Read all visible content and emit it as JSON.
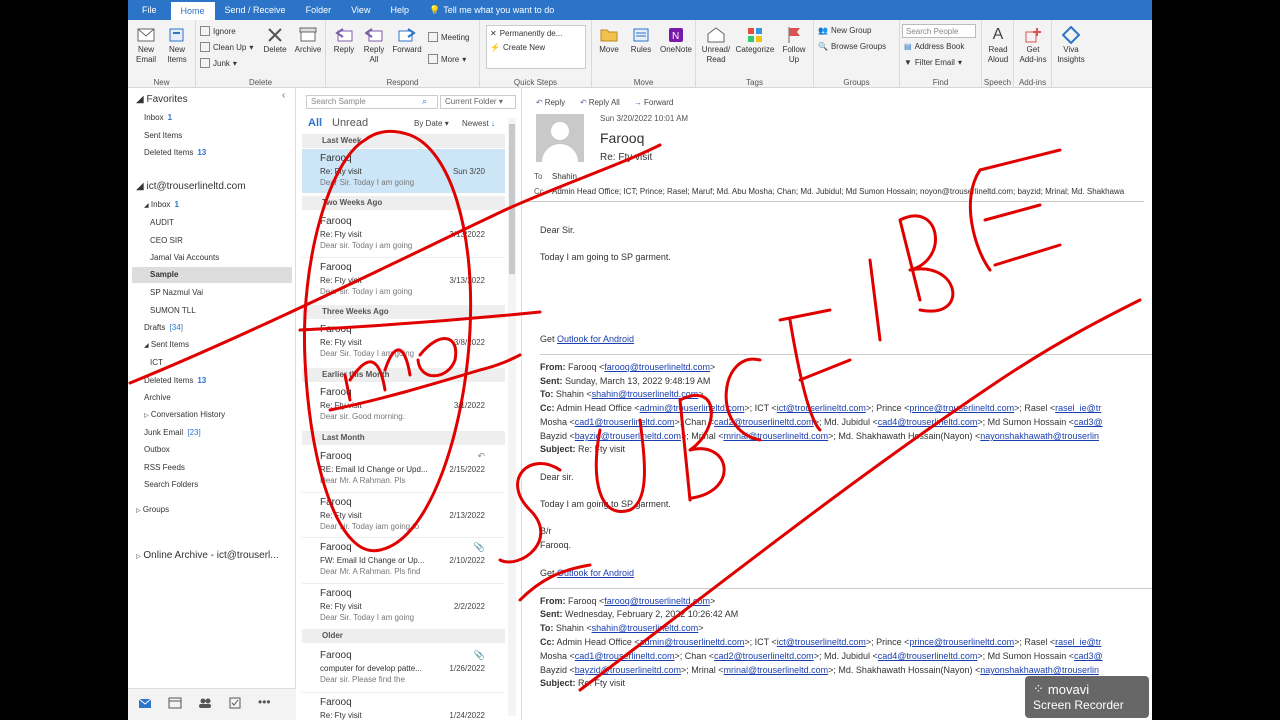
{
  "ribbon_tabs": [
    "File",
    "Home",
    "Send / Receive",
    "Folder",
    "View",
    "Help",
    "Tell me what you want to do"
  ],
  "ribbon": {
    "new_email": "New\nEmail",
    "new_items": "New\nItems",
    "ignore": "Ignore",
    "clean_up": "Clean Up",
    "junk": "Junk",
    "delete": "Delete",
    "archive": "Archive",
    "reply": "Reply",
    "reply_all": "Reply\nAll",
    "forward": "Forward",
    "meeting": "Meeting",
    "more": "More",
    "qs_permanently": "Permanently de...",
    "qs_create_new": "Create New",
    "move": "Move",
    "rules": "Rules",
    "onenote": "OneNote",
    "unread_read": "Unread/\nRead",
    "categorize": "Categorize",
    "follow_up": "Follow\nUp",
    "new_group": "New Group",
    "browse_groups": "Browse Groups",
    "search_people": "Search People",
    "address_book": "Address Book",
    "filter_email": "Filter Email",
    "read_aloud": "Read\nAloud",
    "get_addins": "Get\nAdd-ins",
    "viva_insights": "Viva\nInsights",
    "groups": {
      "new": "New",
      "delete": "Delete",
      "respond": "Respond",
      "quick_steps": "Quick Steps",
      "move": "Move",
      "tags": "Tags",
      "groups": "Groups",
      "find": "Find",
      "speech": "Speech",
      "addins": "Add-ins"
    }
  },
  "folders": {
    "favorites": "Favorites",
    "fav_inbox": "Inbox",
    "fav_inbox_count": "1",
    "fav_sent": "Sent Items",
    "fav_deleted": "Deleted Items",
    "fav_deleted_count": "13",
    "account": "ict@trouserlineltd.com",
    "inbox": "Inbox",
    "inbox_count": "1",
    "audit": "AUDIT",
    "ceo": "CEO SIR",
    "jamal": "Jamal  Vai Accounts",
    "sample": "Sample",
    "sp_nazmul": "SP Nazmul Vai",
    "sumon": "SUMON TLL",
    "drafts": "Drafts",
    "drafts_count": "[34]",
    "sent": "Sent Items",
    "ict": "ICT",
    "deleted": "Deleted Items",
    "deleted_count": "13",
    "archive": "Archive",
    "conversation": "Conversation History",
    "junk": "Junk Email",
    "junk_count": "[23]",
    "outbox": "Outbox",
    "rss": "RSS Feeds",
    "search_folders": "Search Folders",
    "groups": "Groups",
    "online_archive": "Online Archive - ict@trouserl..."
  },
  "list": {
    "search_placeholder": "Search Sample",
    "current_folder": "Current Folder",
    "all": "All",
    "unread": "Unread",
    "by_date": "By Date",
    "newest": "Newest",
    "groups": [
      "Last Week",
      "Two Weeks Ago",
      "Three Weeks Ago",
      "Earlier this Month",
      "Last Month",
      "Older"
    ],
    "messages": [
      {
        "sender": "Farooq",
        "subject": "Re: Fty visit",
        "preview": "Dear Sir.  Today I am going",
        "date": "Sun 3/20"
      },
      {
        "sender": "Farooq",
        "subject": "Re: Fty visit",
        "preview": "Dear sir.  Today i am going",
        "date": "3/13/2022"
      },
      {
        "sender": "Farooq",
        "subject": "Re: Fty visit",
        "preview": "Dear sir.  Today  i am going",
        "date": "3/13/2022"
      },
      {
        "sender": "Farooq",
        "subject": "Re: Fty visit",
        "preview": "Dear Sir.  Today I am going",
        "date": "3/8/2022"
      },
      {
        "sender": "Farooq",
        "subject": "Re: Fty visit",
        "preview": "Dear sir.  Good morning.",
        "date": "3/1/2022"
      },
      {
        "sender": "Farooq",
        "subject": "RE: Email Id Change or Upd...",
        "preview": "Dear Mr. A Rahman.   Pls",
        "date": "2/15/2022"
      },
      {
        "sender": "Farooq",
        "subject": "Re: Fty visit",
        "preview": "Dear sir.  Today iam going to",
        "date": "2/13/2022"
      },
      {
        "sender": "Farooq",
        "subject": "FW: Email Id Change or Up...",
        "preview": "Dear Mr. A Rahman.   Pls find",
        "date": "2/10/2022"
      },
      {
        "sender": "Farooq",
        "subject": "Re: Fty visit",
        "preview": "Dear Sir.  Today I am going",
        "date": "2/2/2022"
      },
      {
        "sender": "Farooq",
        "subject": "computer for develop patte...",
        "preview": "Dear sir.  Please find the",
        "date": "1/26/2022"
      },
      {
        "sender": "Farooq",
        "subject": "Re: Fty visit",
        "preview": "",
        "date": "1/24/2022"
      }
    ]
  },
  "reader": {
    "reply": "Reply",
    "reply_all": "Reply All",
    "forward": "Forward",
    "date": "Sun 3/20/2022 10:01 AM",
    "sender": "Farooq",
    "subject": "Re: Fty visit",
    "to_label": "To",
    "to": "Shahin",
    "cc_label": "Cc",
    "cc": "Admin Head Office; ICT; Prince; Rasel; Maruf; Md. Abu Mosha; Chan; Md. Jubidul; Md Sumon Hossain; noyon@trouserlineltd.com; bayzid; Mrinal; Md. Shakhawa",
    "greeting": "Dear Sir.",
    "line1": "Today I am going to SP garment.",
    "get_outlook": "Get ",
    "outlook_android": "Outlook for Android",
    "q1": {
      "from_label": "From:",
      "from": " Farooq <",
      "from_email": "farooq@trouserlineltd.com",
      "from_end": ">",
      "sent_label": "Sent:",
      "sent": " Sunday, March 13, 2022 9:48:19 AM",
      "to_label": "To:",
      "to": " Shahin <",
      "to_email": "shahin@trouserlineltd.com",
      "to_end": ">",
      "cc_label": "Cc:",
      "cc1": " Admin Head Office <",
      "cc1_email": "admin@trouserlineltd.com",
      "cc1_rest": ">; ICT <",
      "cc2_email": "ict@trouserlineltd.com",
      "cc2_rest": ">; Prince <",
      "cc3_email": "prince@trouserlineltd.com",
      "cc3_rest": ">; Rasel <",
      "cc4_email": "rasel_ie@tr",
      "line2a": "Mosha <",
      "line2_e1": "cad1@trouserlineltd.com",
      "line2b": ">; Chan <",
      "line2_e2": "cad2@trouserlineltd.com",
      "line2c": ">; Md. Jubidul <",
      "line2_e3": "cad4@trouserlineltd.com",
      "line2d": ">; Md Sumon Hossain <",
      "line2_e4": "cad3@",
      "line3a": "Bayzid <",
      "line3_e1": "bayzid@trouserlineltd.com",
      "line3b": ">; Mrinal <",
      "line3_e2": "mrinal@trouserlineltd.com",
      "line3c": ">; Md. Shakhawath Hossain(Nayon) <",
      "line3_e3": "nayonshakhawath@trouserlin",
      "subject_label": "Subject:",
      "subject": " Re: Fty visit",
      "greeting": "Dear sir.",
      "line1": "Today I am going to SP garment.",
      "br": "B/r",
      "name": "Farooq."
    },
    "q2": {
      "from_label": "From:",
      "from": " Farooq <",
      "from_email": "farooq@trouserlineltd.com",
      "from_end": ">",
      "sent_label": "Sent:",
      "sent": " Wednesday, February 2, 2022 10:26:42 AM",
      "to_label": "To:",
      "to": " Shahin <",
      "to_email": "shahin@trouserlineltd.com",
      "to_end": ">",
      "cc_label": "Cc:",
      "cc1": " Admin Head Office <",
      "cc1_email": "admin@trouserlineltd.com",
      "cc1_rest": ">; ICT <",
      "cc2_email": "ict@trouserlineltd.com",
      "cc2_rest": ">; Prince <",
      "cc3_email": "prince@trouserlineltd.com",
      "cc3_rest": ">; Rasel <",
      "cc4_email": "rasel_ie@tr",
      "line2a": "Mosha <",
      "line2_e1": "cad1@trouserlineltd.com",
      "line2b": ">; Chan <",
      "line2_e2": "cad2@trouserlineltd.com",
      "line2c": ">; Md. Jubidul <",
      "line2_e3": "cad4@trouserlineltd.com",
      "line2d": ">; Md Sumon Hossain <",
      "line2_e4": "cad3@",
      "line3a": "Bayzid <",
      "line3_e1": "bayzid@trouserlineltd.com",
      "line3b": ">; Mrinal <",
      "line3_e2": "mrinal@trouserlineltd.com",
      "line3c": ">; Md. Shakhawath Hossain(Nayon) <",
      "line3_e3": "nayonshakhawath@trouserlin",
      "subject_label": "Subject:",
      "subject": " Re: Fty visit"
    }
  },
  "watermark": {
    "brand": "movavi",
    "product": "Screen Recorder"
  },
  "colors": {
    "accent": "#2b74c7",
    "annotation": "#e00000",
    "selected": "#cde6f7"
  }
}
